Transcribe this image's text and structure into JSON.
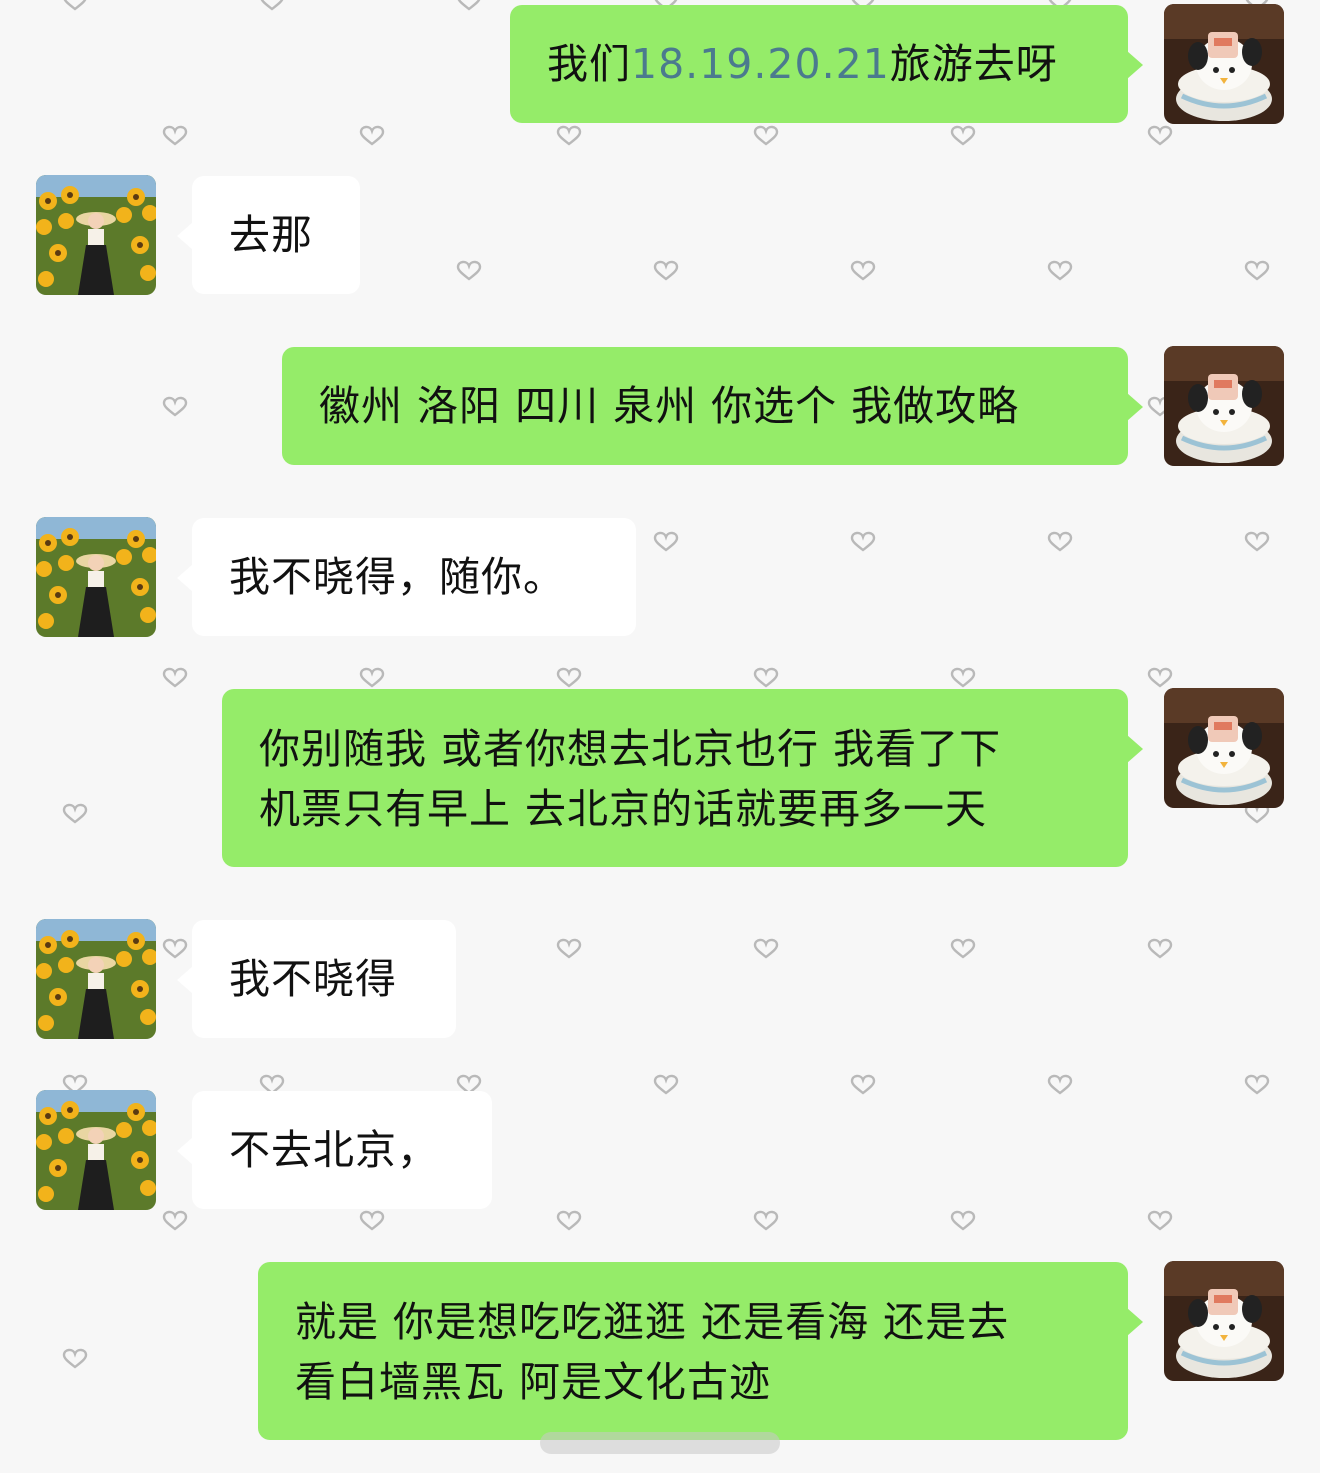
{
  "chat": {
    "messages": [
      {
        "side": "me",
        "prefix": "我们",
        "highlight": "18.19.20.21",
        "suffix": "旅游去呀"
      },
      {
        "side": "them",
        "text": "去那"
      },
      {
        "side": "me",
        "text": "徽州 洛阳 四川 泉州 你选个 我做攻略"
      },
      {
        "side": "them",
        "text": "我不晓得，随你。"
      },
      {
        "side": "me",
        "lines": [
          "你别随我 或者你想去北京也行 我看了下",
          "机票只有早上 去北京的话就要再多一天"
        ]
      },
      {
        "side": "them",
        "text": "我不晓得"
      },
      {
        "side": "them",
        "text": "不去北京，"
      },
      {
        "side": "me",
        "lines": [
          "就是 你是想吃吃逛逛 还是看海 还是去",
          "看白墙黑瓦 阿是文化古迹"
        ]
      }
    ]
  },
  "avatars": {
    "me": "plush-toy-in-basket",
    "them": "girl-in-sunflower-field"
  },
  "colors": {
    "background": "#f7f7f7",
    "my_bubble": "#95ec69",
    "their_bubble": "#ffffff",
    "date_highlight": "#4b7a8e",
    "heart_pattern": "#bdbdbd"
  }
}
